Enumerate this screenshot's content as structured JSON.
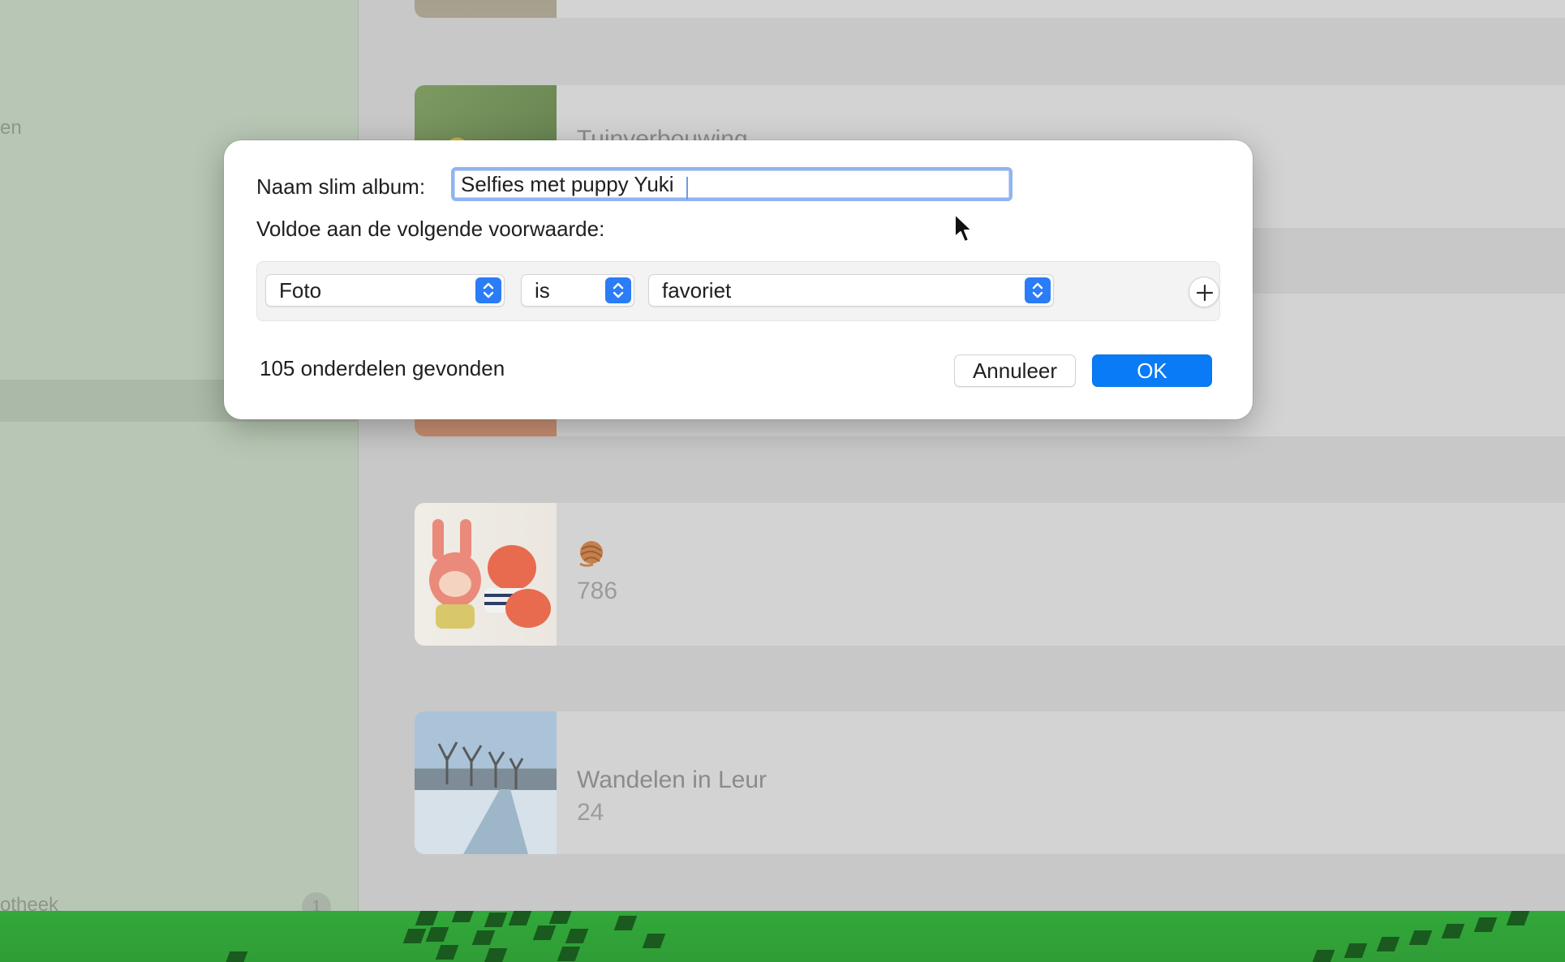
{
  "background": {
    "sidebar": {
      "partial_item_top": "en",
      "partial_item_bottom": "otheek",
      "badge": "1"
    },
    "albums": [
      {
        "title": "",
        "count": ""
      },
      {
        "title": "Tuinverbouwing",
        "count": ""
      },
      {
        "title": "",
        "count": ""
      },
      {
        "title": "",
        "count": "786",
        "emoji": "yarn-ball-icon"
      },
      {
        "title": "Wandelen in Leur",
        "count": "24"
      }
    ]
  },
  "dialog": {
    "name_label": "Naam slim album:",
    "name_value": "Selfies met puppy Yuki",
    "condition_label": "Voldoe aan de volgende voorwaarde:",
    "rule": {
      "field": "Foto",
      "operator": "is",
      "value": "favoriet"
    },
    "found_text": "105 onderdelen gevonden",
    "cancel_label": "Annuleer",
    "ok_label": "OK"
  },
  "colors": {
    "accent": "#0a7bf6",
    "sidebar": "#b8c7b5",
    "dock": "#32a83a"
  }
}
